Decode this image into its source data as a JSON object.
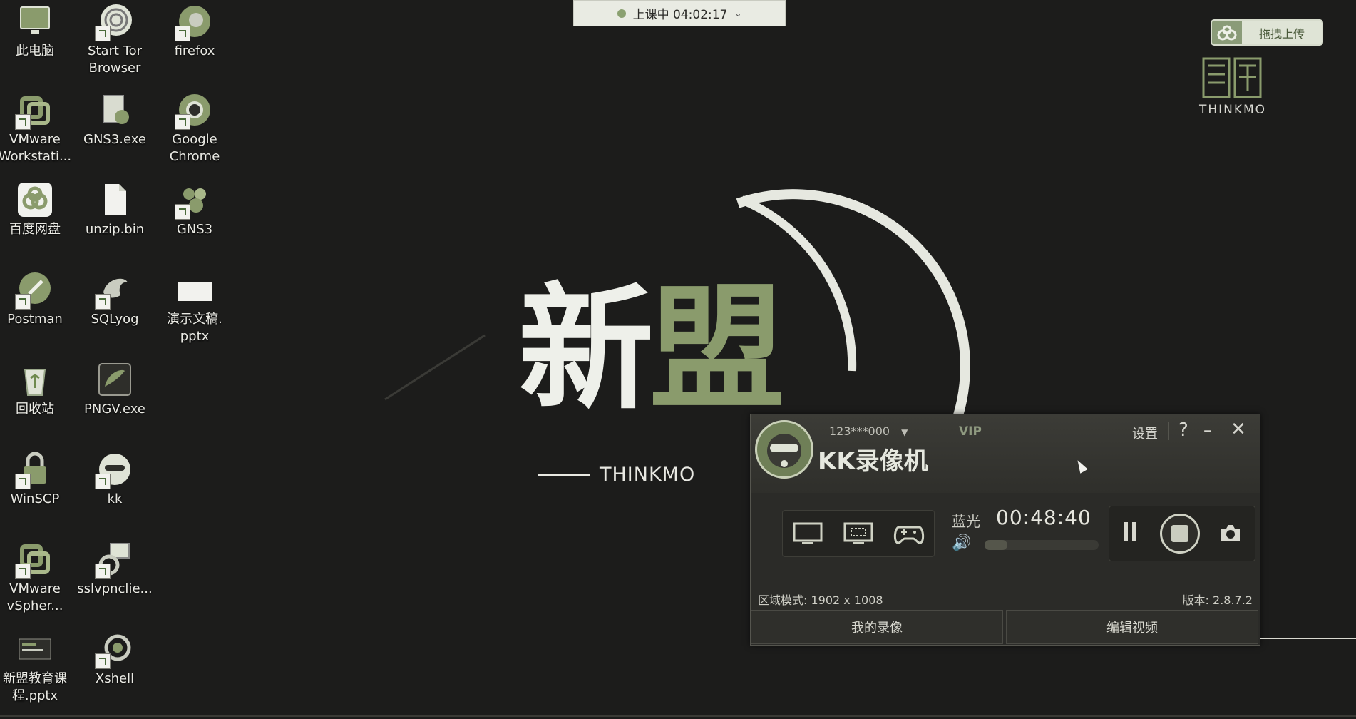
{
  "desktop": {
    "icons": [
      {
        "label": "此电脑",
        "icon": "computer-icon"
      },
      {
        "label": "Start Tor\nBrowser",
        "icon": "tor-icon"
      },
      {
        "label": "firefox",
        "icon": "firefox-icon"
      },
      {
        "label": "VMware\nWorkstati...",
        "icon": "vmware-icon"
      },
      {
        "label": "GNS3.exe",
        "icon": "gns3-installer-icon"
      },
      {
        "label": "Google\nChrome",
        "icon": "chrome-icon"
      },
      {
        "label": "百度网盘",
        "icon": "baidu-netdisk-icon"
      },
      {
        "label": "unzip.bin",
        "icon": "file-icon"
      },
      {
        "label": "GNS3",
        "icon": "gns3-icon"
      },
      {
        "label": "Postman",
        "icon": "postman-icon"
      },
      {
        "label": "SQLyog",
        "icon": "sqlyog-icon"
      },
      {
        "label": "演示文稿.\npptx",
        "icon": "pptx-icon"
      },
      {
        "label": "回收站",
        "icon": "recycle-bin-icon"
      },
      {
        "label": "PNGV.exe",
        "icon": "png-icon"
      },
      {
        "label": "WinSCP",
        "icon": "winscp-icon"
      },
      {
        "label": "kk",
        "icon": "kk-icon"
      },
      {
        "label": "VMware\nvSpher...",
        "icon": "vsphere-icon"
      },
      {
        "label": "sslvpnclie...",
        "icon": "sslvpn-icon"
      },
      {
        "label": "新盟教育课\n程.pptx",
        "icon": "pptx-thumb-icon"
      },
      {
        "label": "Xshell",
        "icon": "xshell-icon"
      }
    ]
  },
  "class_timer": {
    "label": "上课中 04:02:17"
  },
  "upload_widget": {
    "label": "拖拽上传"
  },
  "corner_logo": {
    "text": "THINKMO"
  },
  "wallpaper": {
    "logo_char1": "新",
    "logo_char2": "盟",
    "logo_sub": "THINKMO"
  },
  "kk": {
    "account": "123***000",
    "vip": "VIP",
    "title": "KK录像机",
    "settings": "设置",
    "help": "?",
    "minimize": "–",
    "close": "✕",
    "quality": "蓝光",
    "timer": "00:48:40",
    "volume_level": 0.2,
    "region_mode": "区域模式: 1902 x 1008",
    "version": "版本: 2.8.7.2",
    "my_recordings": "我的录像",
    "edit_video": "编辑视频"
  },
  "colors": {
    "accent": "#8a9b6c",
    "background": "#1c1c1b"
  }
}
